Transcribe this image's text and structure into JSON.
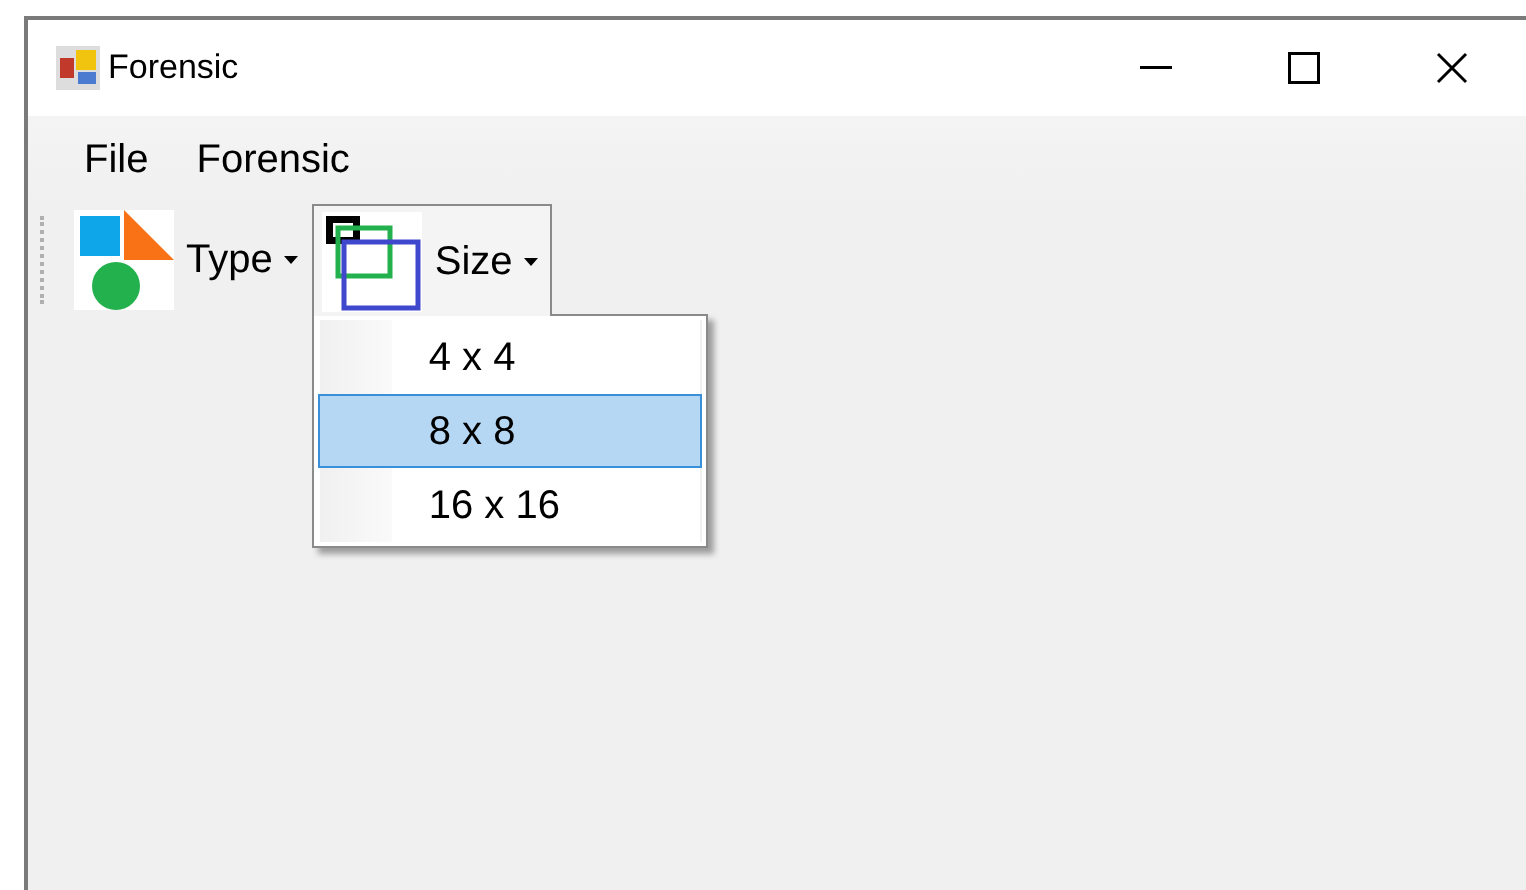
{
  "window": {
    "title": "Forensic"
  },
  "menu": [
    "File",
    "Forensic"
  ],
  "toolbar": [
    {
      "label": "Type",
      "kind": "shapes",
      "open": false
    },
    {
      "label": "Size",
      "kind": "squares",
      "open": true
    }
  ],
  "dropdown": [
    {
      "label": "4 x 4",
      "selected": false
    },
    {
      "label": "8 x 8",
      "selected": true
    },
    {
      "label": "16 x 16",
      "selected": false
    }
  ]
}
